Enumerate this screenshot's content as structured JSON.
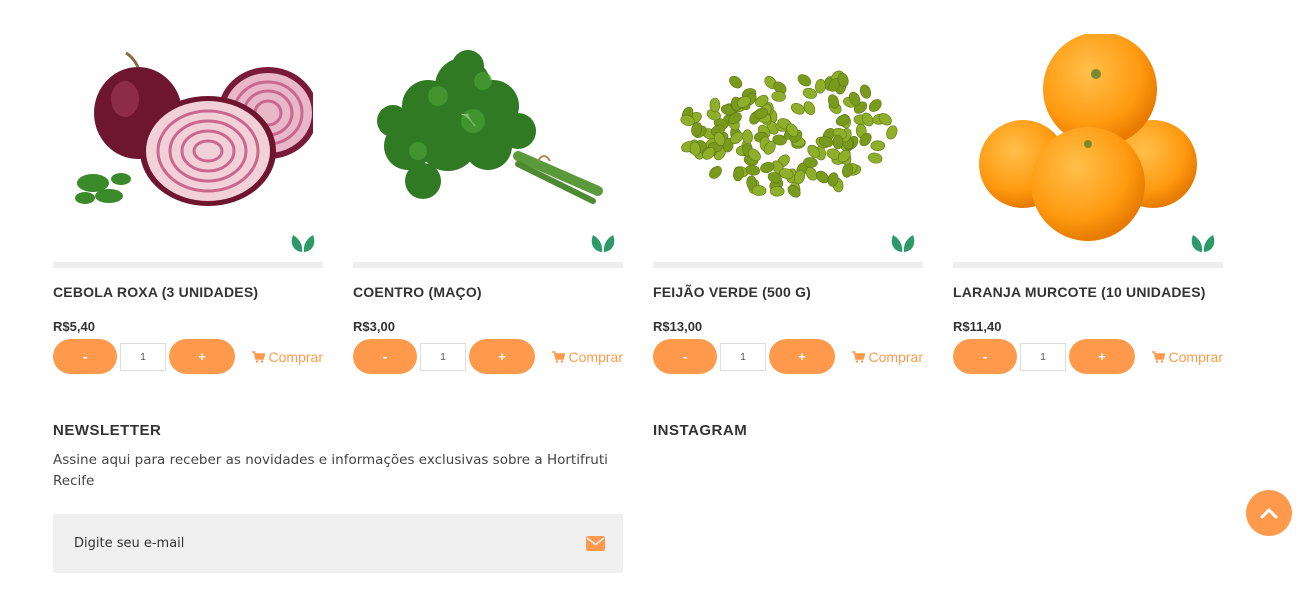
{
  "products": [
    {
      "name": "CEBOLA ROXA (3 UNIDADES)",
      "price": "R$5,40",
      "quantity": "1",
      "image_icon": "red-onion-image",
      "organic_icon": "leaf-icon"
    },
    {
      "name": "COENTRO (MAÇO)",
      "price": "R$3,00",
      "quantity": "1",
      "image_icon": "coriander-image",
      "organic_icon": "leaf-icon"
    },
    {
      "name": "FEIJÃO VERDE (500 G)",
      "price": "R$13,00",
      "quantity": "1",
      "image_icon": "green-beans-image",
      "organic_icon": "leaf-icon"
    },
    {
      "name": "LARANJA MURCOTE (10 UNIDADES)",
      "price": "R$11,40",
      "quantity": "1",
      "image_icon": "tangerine-image",
      "organic_icon": "leaf-icon"
    }
  ],
  "buttons": {
    "minus_label": "-",
    "plus_label": "+",
    "buy_label": "Comprar"
  },
  "newsletter": {
    "title": "NEWSLETTER",
    "description": "Assine aqui para receber as novidades e informações exclusivas sobre a Hortifruti Recife",
    "email_placeholder": "Digite seu e-mail"
  },
  "instagram": {
    "title": "INSTAGRAM"
  },
  "colors": {
    "accent": "#ff9a4d",
    "leaf": "#2e9a6a",
    "divider": "#eeeeee",
    "input_bg": "#f0f0f0"
  },
  "icons": {
    "cart": "cart-icon",
    "mail": "envelope-icon",
    "scroll_top": "chevron-up-icon"
  }
}
